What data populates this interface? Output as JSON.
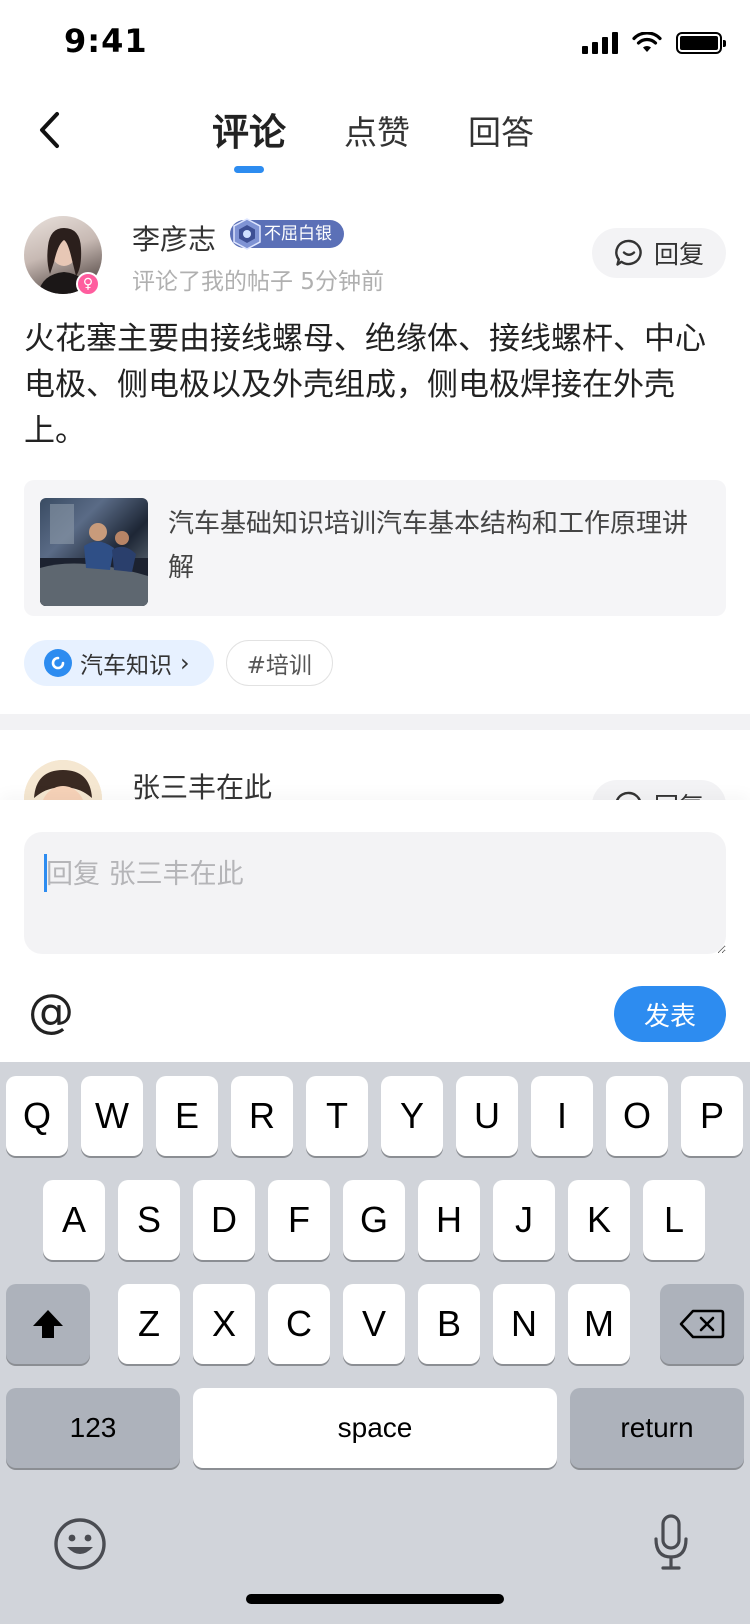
{
  "status_bar": {
    "time": "9:41"
  },
  "nav": {
    "tabs": [
      {
        "label": "评论",
        "active": true
      },
      {
        "label": "点赞",
        "active": false
      },
      {
        "label": "回答",
        "active": false
      }
    ]
  },
  "comment": {
    "username": "李彦志",
    "badge": "不屈白银",
    "subline": "评论了我的帖子 5分钟前",
    "reply_label": "回复",
    "text": "火花塞主要由接线螺母、绝缘体、接线螺杆、中心电极、侧电极以及外壳组成，侧电极焊接在外壳上。",
    "linked_post_title": "汽车基础知识培训汽车基本结构和工作原理讲解",
    "topic_tag": "汽车知识",
    "topic_chevron": "›",
    "plain_tag": "#培训"
  },
  "comment2": {
    "username": "张三丰在此",
    "reply_label": "回复"
  },
  "composer": {
    "placeholder": "回复 张三丰在此",
    "at_symbol": "@",
    "send_label": "发表"
  },
  "keyboard": {
    "row1": [
      "Q",
      "W",
      "E",
      "R",
      "T",
      "Y",
      "U",
      "I",
      "O",
      "P"
    ],
    "row2": [
      "A",
      "S",
      "D",
      "F",
      "G",
      "H",
      "J",
      "K",
      "L"
    ],
    "row3": [
      "Z",
      "X",
      "C",
      "V",
      "B",
      "N",
      "M"
    ],
    "numbers_label": "123",
    "space_label": "space",
    "return_label": "return"
  },
  "colors": {
    "accent": "#2d8cf0",
    "badge": "#5b70b7",
    "keyboard_bg": "#d1d4da"
  }
}
